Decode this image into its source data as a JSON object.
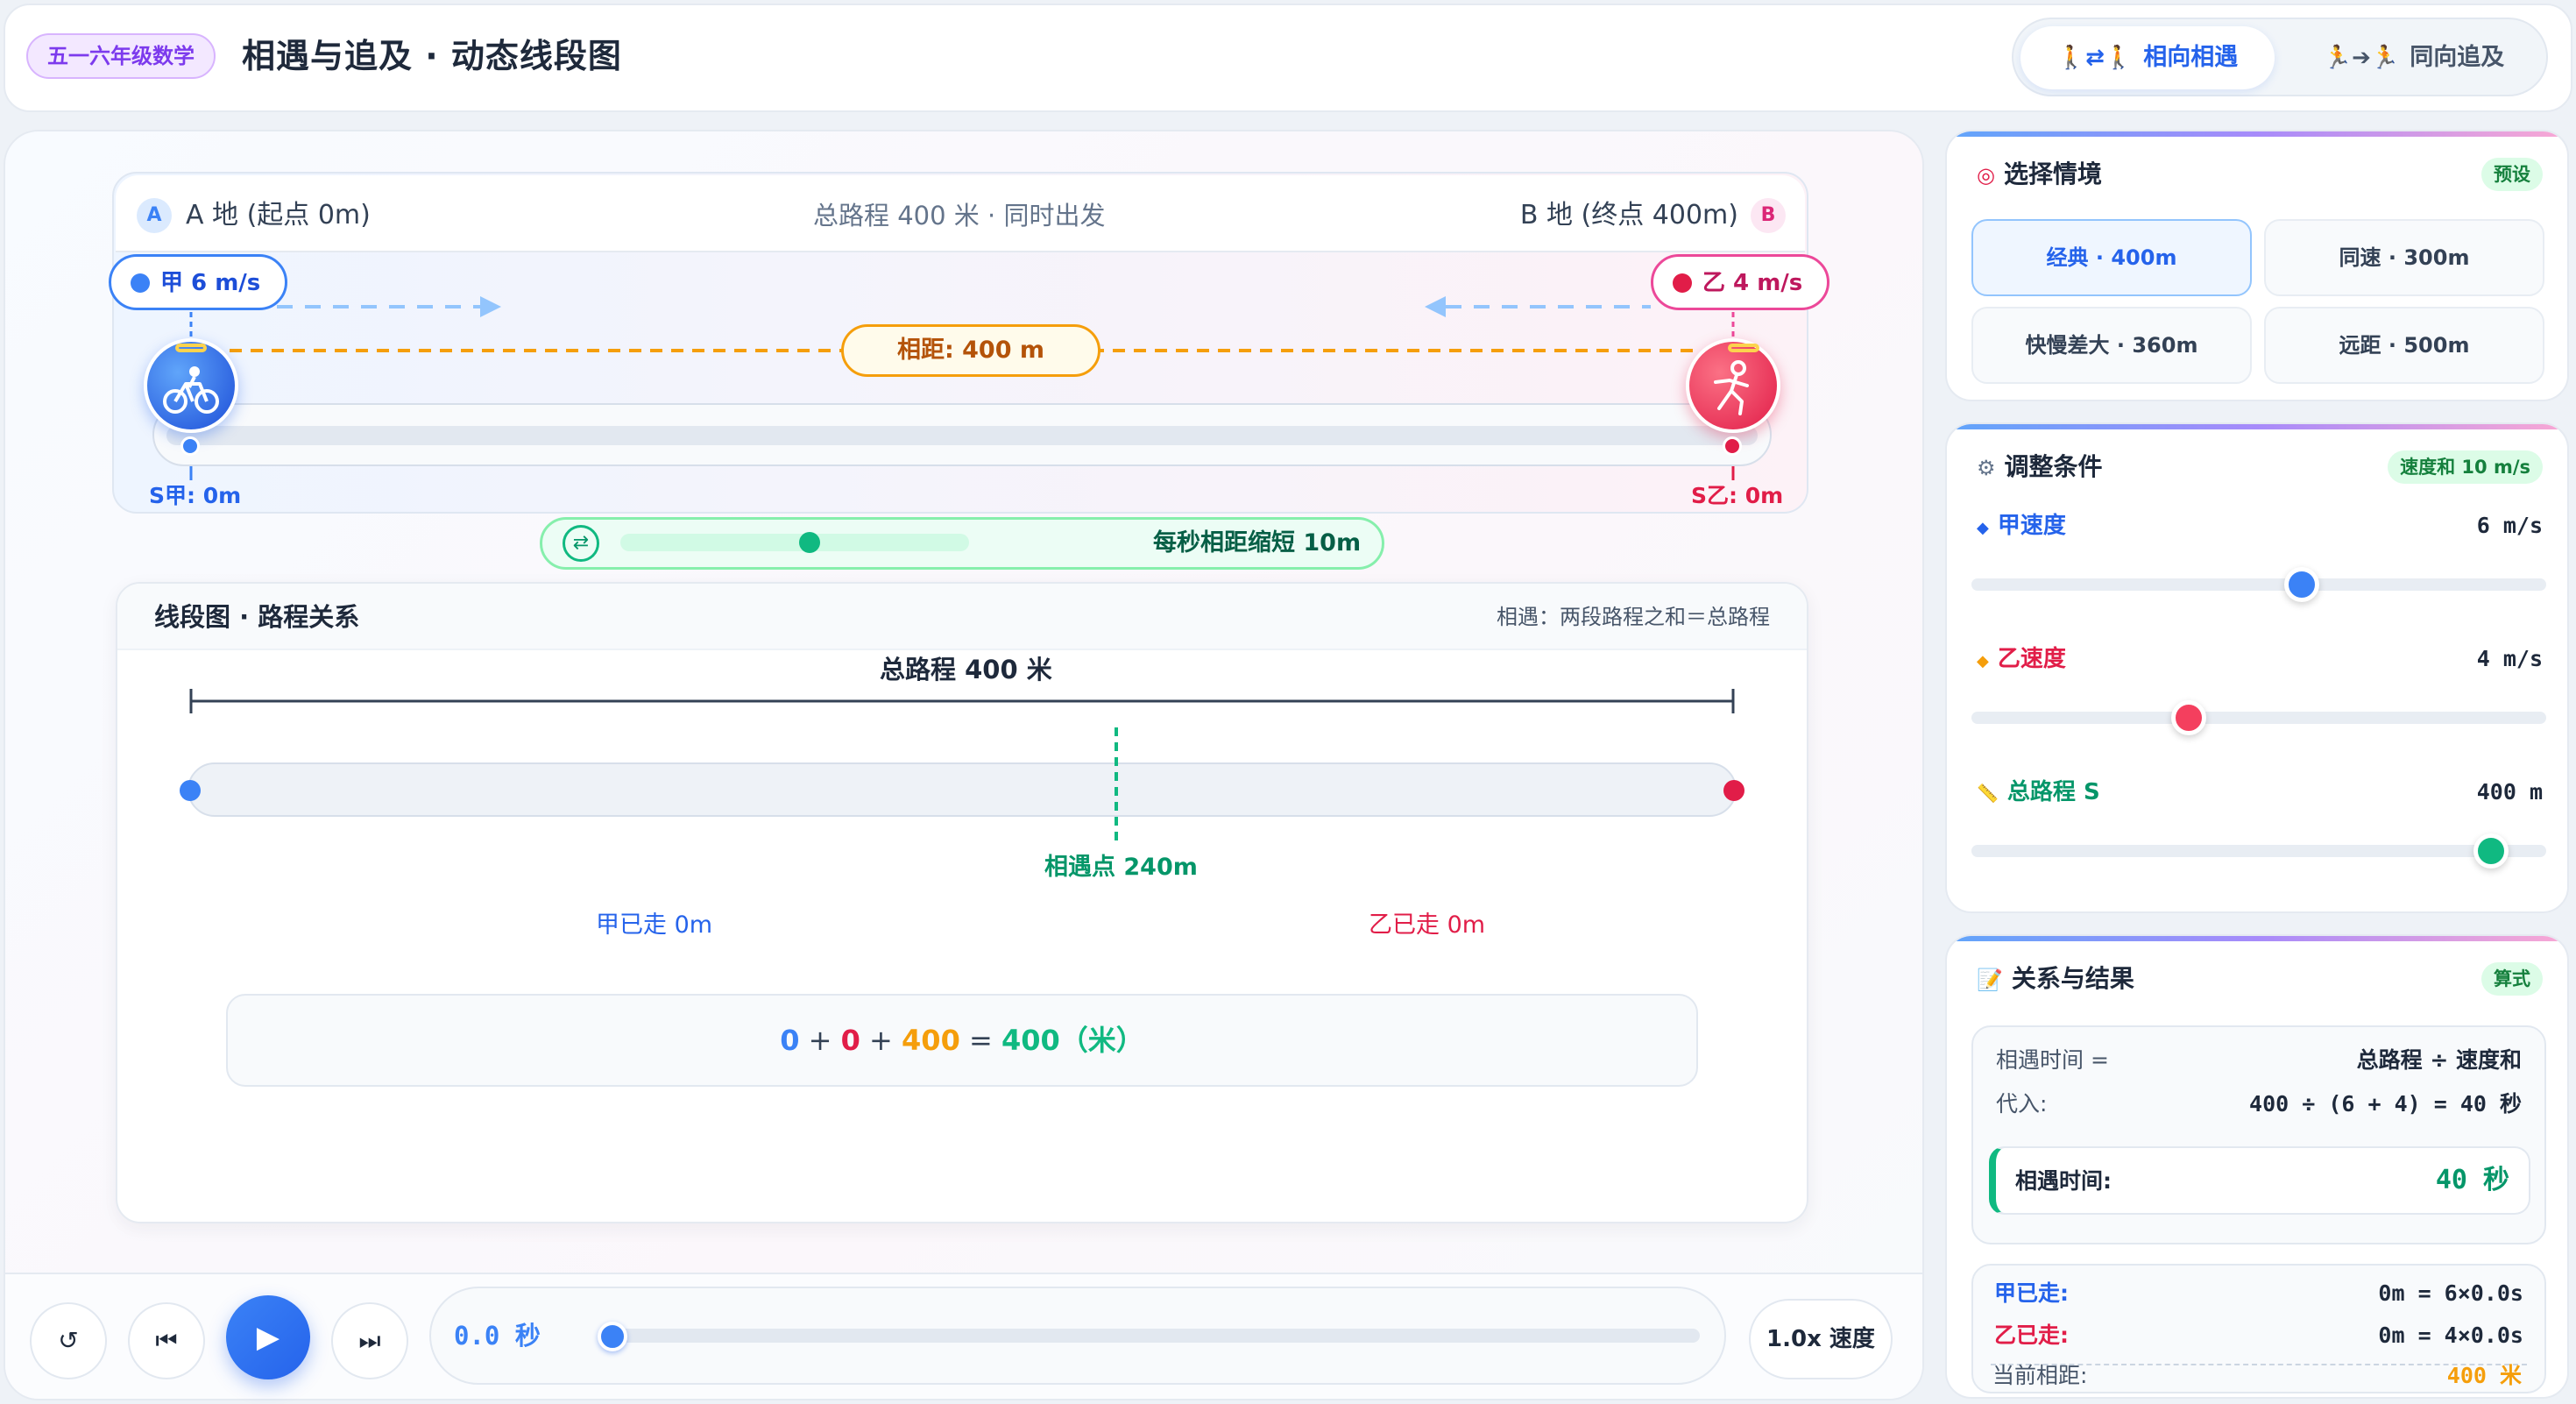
{
  "header": {
    "grade_badge": "五一六年级数学",
    "title": "相遇与追及 · 动态线段图",
    "tabs": [
      {
        "glyph": "🚶⇄🚶",
        "label": "相向相遇"
      },
      {
        "glyph": "🏃➔🏃",
        "label": "同向追及"
      }
    ]
  },
  "track": {
    "place_a_letter": "A",
    "place_a": "A 地 (起点 0m)",
    "route_info": "总路程 400 米 · 同时出发",
    "place_b": "B 地 (终点 400m)",
    "place_b_letter": "B",
    "speed_jia": "甲 6 m/s",
    "speed_yi": "乙 4 m/s",
    "distance_tag": "相距: 400 m",
    "pos_jia": "S甲: 0m",
    "pos_yi": "S乙: 0m",
    "closing_label": "每秒相距缩短 10m",
    "closing_icon": "⇄",
    "icon_jia": "bicycle-icon",
    "icon_yi": "runner-icon"
  },
  "segment": {
    "title": "线段图 · 路程关系",
    "relation": "相遇：两段路程之和＝总路程",
    "total_label": "总路程 400 米",
    "meet_label": "相遇点 240m",
    "walked_jia": "甲已走 0m",
    "walked_yi": "乙已走 0m",
    "eq_a": "0",
    "eq_b": "0",
    "eq_c": "400",
    "eq_total": "400（米）",
    "op_plus": "+",
    "op_eq": "=",
    "meet_point_fraction": 0.6
  },
  "controls": {
    "reset_glyph": "↺",
    "prev_glyph": "⏮",
    "play_glyph": "▶",
    "next_glyph": "⏭",
    "time_readout": "0.0 秒",
    "progress_fraction": 0.0,
    "speed_label": "1.0x 速度"
  },
  "scenario": {
    "title": "选择情境",
    "icon": "target-icon",
    "badge": "预设",
    "options": [
      "经典 · 400m",
      "同速 · 300m",
      "快慢差大 · 360m",
      "远距 · 500m"
    ],
    "selected": "经典 · 400m"
  },
  "conditions": {
    "title": "调整条件",
    "icon": "gear-icon",
    "badge": "速度和 10 m/s",
    "items": [
      {
        "label": "甲速度",
        "value": "6 m/s",
        "color": "#3b82f6",
        "fraction": 0.58
      },
      {
        "label": "乙速度",
        "value": "4 m/s",
        "color": "#f43f5e",
        "fraction": 0.37
      },
      {
        "label": "总路程 S",
        "value": "400 m",
        "color": "#10b981",
        "fraction": 0.93
      }
    ]
  },
  "result": {
    "title": "关系与结果",
    "icon": "memo-icon",
    "badge": "算式",
    "formula_left": "相遇时间 =",
    "formula_right": "总路程 ÷ 速度和",
    "sub_left": "代入:",
    "sub_right": "400 ÷ (6 + 4) = 40 秒",
    "meet_time_label": "相遇时间:",
    "meet_time_value": "40 秒",
    "jia_walked_label": "甲已走:",
    "jia_walked_value": "0m = 6×0.0s",
    "yi_walked_label": "乙已走:",
    "yi_walked_value": "0m = 4×0.0s",
    "current_dist_label": "当前相距:",
    "current_dist_value": "400 米"
  },
  "colors": {
    "jia": "#3b82f6",
    "yi": "#e11d48",
    "gap": "#f59e0b",
    "meet": "#10b981"
  }
}
